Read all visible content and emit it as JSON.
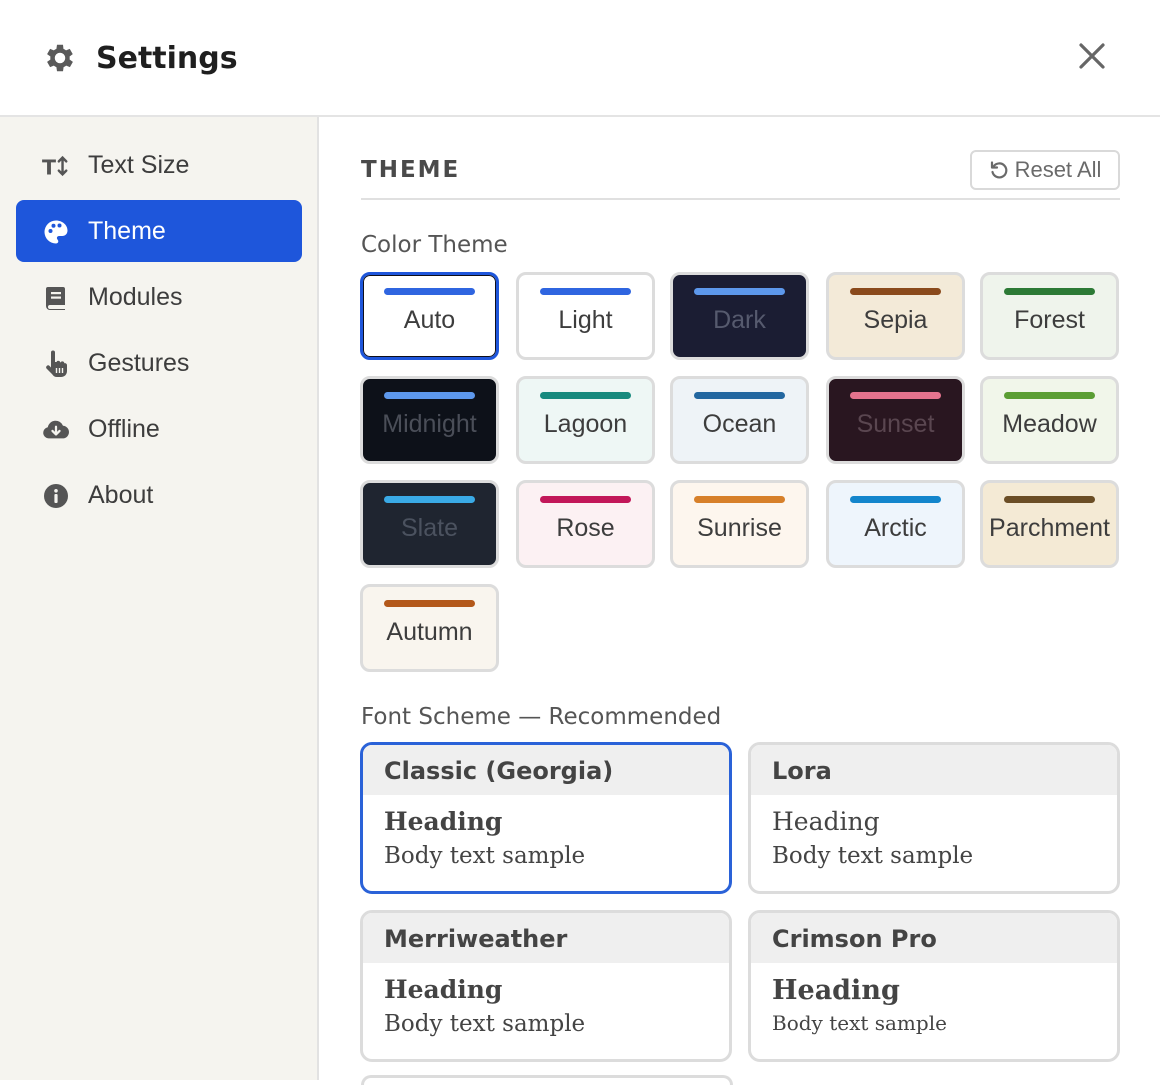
{
  "header": {
    "title": "Settings",
    "icons": {
      "gear": "gear-icon",
      "close": "close-icon"
    }
  },
  "sidebar": {
    "items": [
      {
        "label": "Text Size",
        "icon": "text-size-icon",
        "active": false
      },
      {
        "label": "Theme",
        "icon": "palette-icon",
        "active": true
      },
      {
        "label": "Modules",
        "icon": "book-icon",
        "active": false
      },
      {
        "label": "Gestures",
        "icon": "pointer-hand-icon",
        "active": false
      },
      {
        "label": "Offline",
        "icon": "cloud-download-icon",
        "active": false
      },
      {
        "label": "About",
        "icon": "info-icon",
        "active": false
      }
    ]
  },
  "main": {
    "section_title": "THEME",
    "reset_label": "Reset All",
    "color_theme_label": "Color Theme",
    "themes": [
      {
        "name": "Auto",
        "bg": "#ffffff",
        "bar": "#2f65e0",
        "text": "#3d3d3d",
        "selected": true
      },
      {
        "name": "Light",
        "bg": "#ffffff",
        "bar": "#2f65e0",
        "text": "#3d3d3d"
      },
      {
        "name": "Dark",
        "bg": "#1b1d33",
        "bar": "#5d98ec",
        "text": "#565a6e"
      },
      {
        "name": "Sepia",
        "bg": "#f3ead8",
        "bar": "#8a4a1c",
        "text": "#3d3d3d"
      },
      {
        "name": "Forest",
        "bg": "#eff4ec",
        "bar": "#2d7a36",
        "text": "#3d3d3d"
      },
      {
        "name": "Midnight",
        "bg": "#0d1119",
        "bar": "#5d98ec",
        "text": "#4a4e58"
      },
      {
        "name": "Lagoon",
        "bg": "#eef7f5",
        "bar": "#178a7e",
        "text": "#3d3d3d"
      },
      {
        "name": "Ocean",
        "bg": "#eef3f7",
        "bar": "#2367a0",
        "text": "#3d3d3d"
      },
      {
        "name": "Sunset",
        "bg": "#291620",
        "bar": "#e5738e",
        "text": "#5a4650"
      },
      {
        "name": "Meadow",
        "bg": "#f1f6ea",
        "bar": "#5b9e34",
        "text": "#3d3d3d"
      },
      {
        "name": "Slate",
        "bg": "#1f2530",
        "bar": "#3aaae6",
        "text": "#4b525f"
      },
      {
        "name": "Rose",
        "bg": "#fcf1f3",
        "bar": "#c21759",
        "text": "#3d3d3d"
      },
      {
        "name": "Sunrise",
        "bg": "#fdf6ee",
        "bar": "#d7802a",
        "text": "#3d3d3d"
      },
      {
        "name": "Arctic",
        "bg": "#eef5fc",
        "bar": "#1385cc",
        "text": "#3d3d3d"
      },
      {
        "name": "Parchment",
        "bg": "#f4ead5",
        "bar": "#6b4e26",
        "text": "#3d3d3d"
      },
      {
        "name": "Autumn",
        "bg": "#f9f5ee",
        "bar": "#b3581a",
        "text": "#3d3d3d"
      }
    ],
    "font_scheme_label": "Font Scheme — Recommended",
    "font_schemes": [
      {
        "name": "Classic (Georgia)",
        "heading": "Heading",
        "body": "Body text sample",
        "selected": true
      },
      {
        "name": "Lora",
        "heading": "Heading",
        "body": "Body text sample"
      },
      {
        "name": "Merriweather",
        "heading": "Heading",
        "body": "Body text sample"
      },
      {
        "name": "Crimson Pro",
        "heading": "Heading",
        "body": "Body text sample"
      }
    ]
  }
}
